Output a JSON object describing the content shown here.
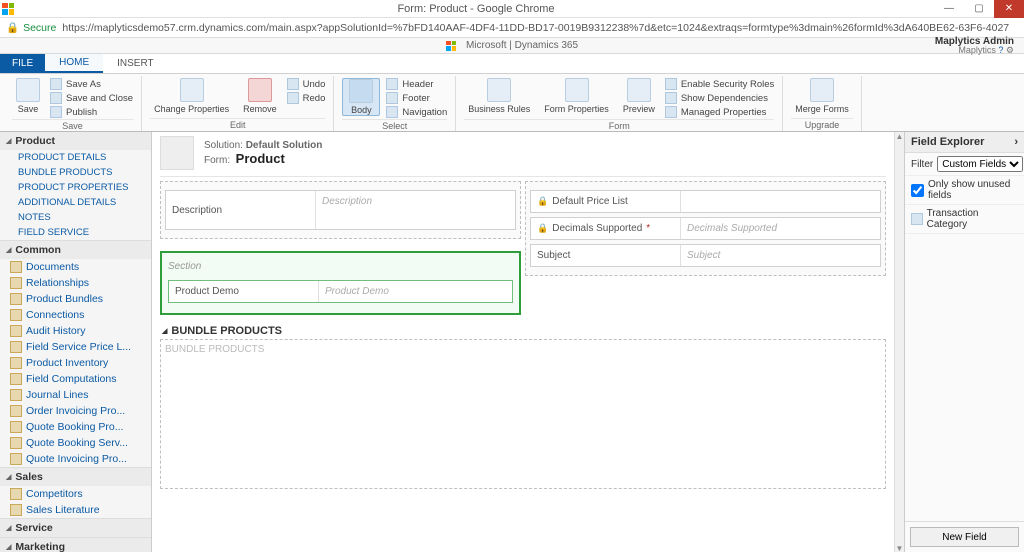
{
  "window": {
    "title": "Form: Product - Google Chrome"
  },
  "address": {
    "secure": "Secure",
    "url": "https://maplyticsdemo57.crm.dynamics.com/main.aspx?appSolutionId=%7bFD140AAF-4DF4-11DD-BD17-0019B9312238%7d&etc=1024&extraqs=formtype%3dmain%26formId%3dA640BE62-63F6-4027"
  },
  "brand": {
    "center": "Microsoft  |  Dynamics 365",
    "admin": "Maplytics Admin",
    "org": "Maplytics"
  },
  "tabs": {
    "file": "FILE",
    "home": "HOME",
    "insert": "INSERT"
  },
  "ribbon": {
    "save": "Save",
    "save_as": "Save As",
    "save_close": "Save and Close",
    "publish": "Publish",
    "save_grp": "Save",
    "change_props": "Change Properties",
    "remove": "Remove",
    "undo": "Undo",
    "redo": "Redo",
    "edit_grp": "Edit",
    "body": "Body",
    "header": "Header",
    "footer": "Footer",
    "navigation": "Navigation",
    "select_grp": "Select",
    "biz_rules": "Business Rules",
    "form_props": "Form Properties",
    "preview": "Preview",
    "enable_sec": "Enable Security Roles",
    "show_dep": "Show Dependencies",
    "managed_props": "Managed Properties",
    "form_grp": "Form",
    "merge_forms": "Merge Forms",
    "upgrade_grp": "Upgrade"
  },
  "leftnav": {
    "product": "Product",
    "product_items": [
      "PRODUCT DETAILS",
      "BUNDLE PRODUCTS",
      "PRODUCT PROPERTIES",
      "ADDITIONAL DETAILS",
      "NOTES",
      "FIELD SERVICE"
    ],
    "common": "Common",
    "common_items": [
      "Documents",
      "Relationships",
      "Product Bundles",
      "Connections",
      "Audit History",
      "Field Service Price L...",
      "Product Inventory",
      "Field Computations",
      "Journal Lines",
      "Order Invoicing Pro...",
      "Quote Booking Pro...",
      "Quote Booking Serv...",
      "Quote Invoicing Pro..."
    ],
    "sales": "Sales",
    "sales_items": [
      "Competitors",
      "Sales Literature"
    ],
    "service": "Service",
    "marketing": "Marketing"
  },
  "formhdr": {
    "solution_lbl": "Solution:",
    "solution_val": "Default Solution",
    "form_lbl": "Form:",
    "form_val": "Product"
  },
  "canvas": {
    "description": "Description",
    "section": "Section",
    "product_demo": "Product Demo",
    "default_pl": "Default Price List",
    "decimals": "Decimals Supported",
    "subject": "Subject",
    "bundle_h": "BUNDLE PRODUCTS",
    "bundle_ph": "BUNDLE PRODUCTS"
  },
  "explorer": {
    "title": "Field Explorer",
    "filter_lbl": "Filter",
    "filter_val": "Custom Fields",
    "only_unused": "Only show unused fields",
    "field1": "Transaction Category",
    "new_field": "New Field"
  }
}
